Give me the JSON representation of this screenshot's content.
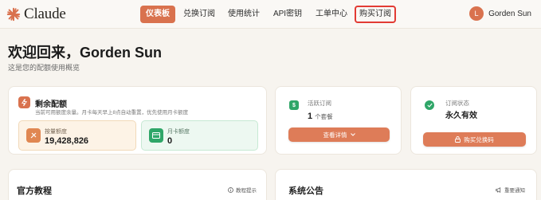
{
  "header": {
    "logo_text": "Claude",
    "nav": [
      {
        "label": "仪表板",
        "active": true
      },
      {
        "label": "兑换订阅",
        "active": false
      },
      {
        "label": "使用统计",
        "active": false
      },
      {
        "label": "API密钥",
        "active": false
      },
      {
        "label": "工单中心",
        "active": false
      },
      {
        "label": "购买订阅",
        "active": false,
        "highlighted": true
      }
    ],
    "user": {
      "avatar_letter": "L",
      "name": "Gorden Sun"
    }
  },
  "welcome": {
    "title": "欢迎回来，Gorden Sun",
    "subtitle": "这是您的配额使用概览"
  },
  "quota_card": {
    "title": "剩余配额",
    "description": "当前可用额度余量。月卡每天早上8点自动重置，优先使用月卡额度",
    "icon": "lightning-icon",
    "metrics": [
      {
        "label": "按量额度",
        "value": "19,428,826",
        "icon": "wallet-icon"
      },
      {
        "label": "月卡额度",
        "value": "0",
        "icon": "card-icon"
      }
    ]
  },
  "subscription_card": {
    "label": "活跃订阅",
    "count": "1",
    "unit": "个套餐",
    "button": "查看详情"
  },
  "status_card": {
    "label": "订阅状态",
    "value": "永久有效",
    "button": "购买兑换码"
  },
  "tutorial_card": {
    "title": "官方教程",
    "hint": "教程提示"
  },
  "notice_card": {
    "title": "系统公告",
    "hint": "重要通知"
  },
  "colors": {
    "accent": "#d9724e",
    "background": "#f7f4ef",
    "success": "#2fa668",
    "highlight_border": "#e23b34"
  }
}
